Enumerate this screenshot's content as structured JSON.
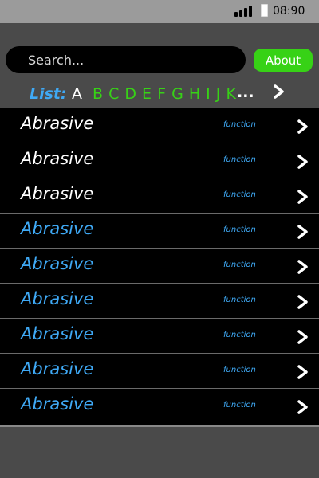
{
  "status_bar": {
    "time": "08:90",
    "signal_icon": "signal-bars-icon",
    "battery_icon": "battery-icon"
  },
  "search": {
    "placeholder": "Search..."
  },
  "about_button": {
    "label": "About"
  },
  "alphabet": {
    "label": "List:",
    "selected": "A",
    "letters": "B C D E F G H I J K",
    "more": "...",
    "next_icon": "chevron-right-icon"
  },
  "colors": {
    "accent_green": "#37d216",
    "accent_blue": "#3fa9f5",
    "row_background": "#000000",
    "page_background": "#4a4a4a",
    "status_bar": "#9b9b9b"
  },
  "list": {
    "items": [
      {
        "title": "Abrasive",
        "type": "function",
        "title_color": "#ffffff"
      },
      {
        "title": "Abrasive",
        "type": "function",
        "title_color": "#ffffff"
      },
      {
        "title": "Abrasive",
        "type": "function",
        "title_color": "#ffffff"
      },
      {
        "title": "Abrasive",
        "type": "function",
        "title_color": "#3fa9f5"
      },
      {
        "title": "Abrasive",
        "type": "function",
        "title_color": "#3fa9f5"
      },
      {
        "title": "Abrasive",
        "type": "function",
        "title_color": "#3fa9f5"
      },
      {
        "title": "Abrasive",
        "type": "function",
        "title_color": "#3fa9f5"
      },
      {
        "title": "Abrasive",
        "type": "function",
        "title_color": "#3fa9f5"
      },
      {
        "title": "Abrasive",
        "type": "function",
        "title_color": "#3fa9f5"
      }
    ]
  }
}
